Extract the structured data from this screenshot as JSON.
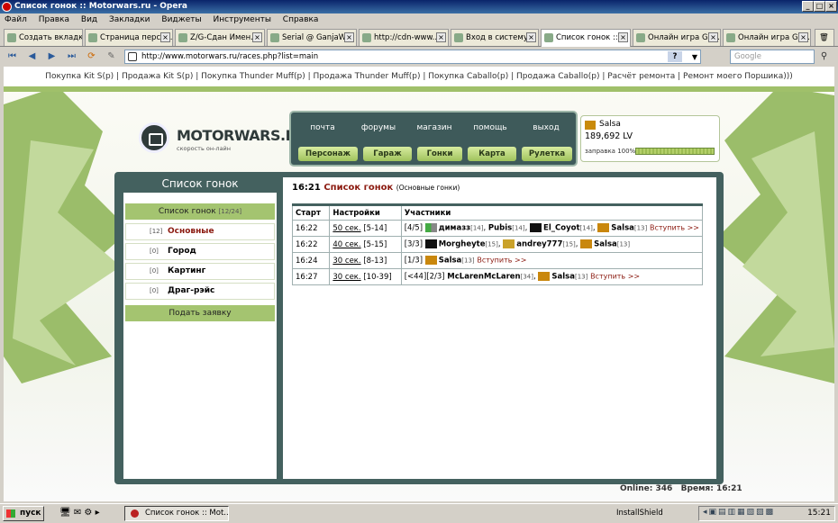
{
  "window": {
    "title": "Список гонок :: Motorwars.ru - Opera"
  },
  "menu": [
    "Файл",
    "Правка",
    "Вид",
    "Закладки",
    "Виджеты",
    "Инструменты",
    "Справка"
  ],
  "tabs": [
    {
      "label": "Создать вкладку"
    },
    {
      "label": "Страница персо..."
    },
    {
      "label": "Z/G-Сдан Имен..."
    },
    {
      "label": "Serial @ GanjaW..."
    },
    {
      "label": "http://cdn-www..."
    },
    {
      "label": "Вход в систему"
    },
    {
      "label": "Список гонок ::..."
    },
    {
      "label": "Онлайн игра Ga..."
    },
    {
      "label": "Онлайн игра Ga..."
    }
  ],
  "address": {
    "url": "http://www.motorwars.ru/races.php?list=main",
    "search_placeholder": "Google"
  },
  "topnav": "Покупка Kit S(p) | Продажа Kit S(p) | Покупка Thunder Muff(p) | Продажа Thunder Muff(p) | Покупка Caballo(p) | Продажа Caballo(p) | Расчёт ремонта | Ремонт моего Поршика)))",
  "logo": {
    "name": "MOTORWARS.RU",
    "tagline": "скорость он-лайн"
  },
  "mainmenu": {
    "top": [
      "почта",
      "форумы",
      "магазин",
      "помощь",
      "выход"
    ],
    "buttons": [
      "Персонаж",
      "Гараж",
      "Гонки",
      "Карта",
      "Рулетка"
    ]
  },
  "user": {
    "name": "Salsa",
    "money": "189,692 LV",
    "fuel": "заправка 100%",
    "fuel_pct": 100
  },
  "sidebar": {
    "title": "Список гонок",
    "header": "Список гонок",
    "header_count": "[12/24]",
    "items": [
      {
        "count": "[12]",
        "label": "Основные"
      },
      {
        "count": "[0]",
        "label": "Город"
      },
      {
        "count": "[0]",
        "label": "Картинг"
      },
      {
        "count": "[0]",
        "label": "Драг-рэйс"
      }
    ],
    "submit": "Подать заявку"
  },
  "races": {
    "time": "16:21",
    "title": "Список гонок",
    "subtitle": "(Основные гонки)",
    "columns": [
      "Старт",
      "Настройки",
      "Участники"
    ],
    "rows": [
      {
        "start": "16:22",
        "duration": "50 сек.",
        "range": "[5-14]",
        "slots": "[4/5]",
        "players": [
          {
            "n": "димазз",
            "l": "[14]",
            "p": "g"
          },
          {
            "n": "Pubis",
            "l": "[14]",
            "p": ""
          },
          {
            "n": "El_Coyot",
            "l": "[14]",
            "p": "b"
          },
          {
            "n": "Salsa",
            "l": "[13]",
            "p": "o"
          }
        ],
        "join": "Вступить >>"
      },
      {
        "start": "16:22",
        "duration": "40 сек.",
        "range": "[5-15]",
        "slots": "[3/3]",
        "players": [
          {
            "n": "Morgheyte",
            "l": "[15]",
            "p": "b"
          },
          {
            "n": "andrey777",
            "l": "[15]",
            "p": "y"
          },
          {
            "n": "Salsa",
            "l": "[13]",
            "p": "o"
          }
        ],
        "join": ""
      },
      {
        "start": "16:24",
        "duration": "30 сек.",
        "range": "[8-13]",
        "slots": "[1/3]",
        "players": [
          {
            "n": "Salsa",
            "l": "[13]",
            "p": "o"
          }
        ],
        "join": "Вступить >>"
      },
      {
        "start": "16:27",
        "duration": "30 сек.",
        "range": "[10-39]",
        "slots": "[<44][2/3]",
        "players": [
          {
            "n": "McLarenMcLaren",
            "l": "[34]",
            "p": ""
          },
          {
            "n": "Salsa",
            "l": "[13]",
            "p": "o"
          }
        ],
        "join": "Вступить >>"
      }
    ]
  },
  "footer": {
    "online": "Online: 346",
    "time": "Время: 16:21"
  },
  "taskbar": {
    "start": "пуск",
    "item": "Список гонок :: Mot...",
    "installshield": "InstallShield",
    "clock": "15:21"
  }
}
